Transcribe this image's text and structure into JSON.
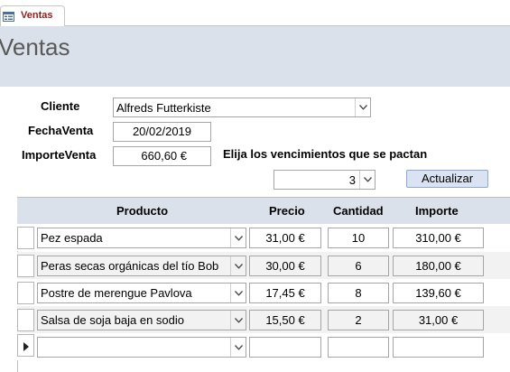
{
  "tab": {
    "label": "Ventas"
  },
  "header": {
    "title": "Ventas"
  },
  "form": {
    "cliente_label": "Cliente",
    "cliente_value": "Alfreds Futterkiste",
    "fecha_label": "FechaVenta",
    "fecha_value": "20/02/2019",
    "importe_label": "ImporteVenta",
    "importe_value": "660,60 €",
    "vencimientos_label": "Elija los vencimientos que se pactan",
    "vencimientos_value": "3",
    "actualizar_label": "Actualizar"
  },
  "grid": {
    "columns": [
      "Producto",
      "Precio",
      "Cantidad",
      "Importe"
    ],
    "rows": [
      {
        "producto": "Pez espada",
        "precio": "31,00 €",
        "cantidad": "10",
        "importe": "310,00 €"
      },
      {
        "producto": "Peras secas orgánicas del tío Bob",
        "precio": "30,00 €",
        "cantidad": "6",
        "importe": "180,00 €"
      },
      {
        "producto": "Postre de merengue Pavlova",
        "precio": "17,45 €",
        "cantidad": "8",
        "importe": "139,60 €"
      },
      {
        "producto": "Salsa de soja baja en sodio",
        "precio": "15,50 €",
        "cantidad": "2",
        "importe": "31,00 €"
      }
    ],
    "new_row": {
      "producto": "",
      "precio": "",
      "cantidad": "",
      "importe": ""
    }
  },
  "colors": {
    "header_bg": "#dbe1ea",
    "tab_text": "#8f1e1e",
    "alt_row": "#f2f2f2"
  }
}
